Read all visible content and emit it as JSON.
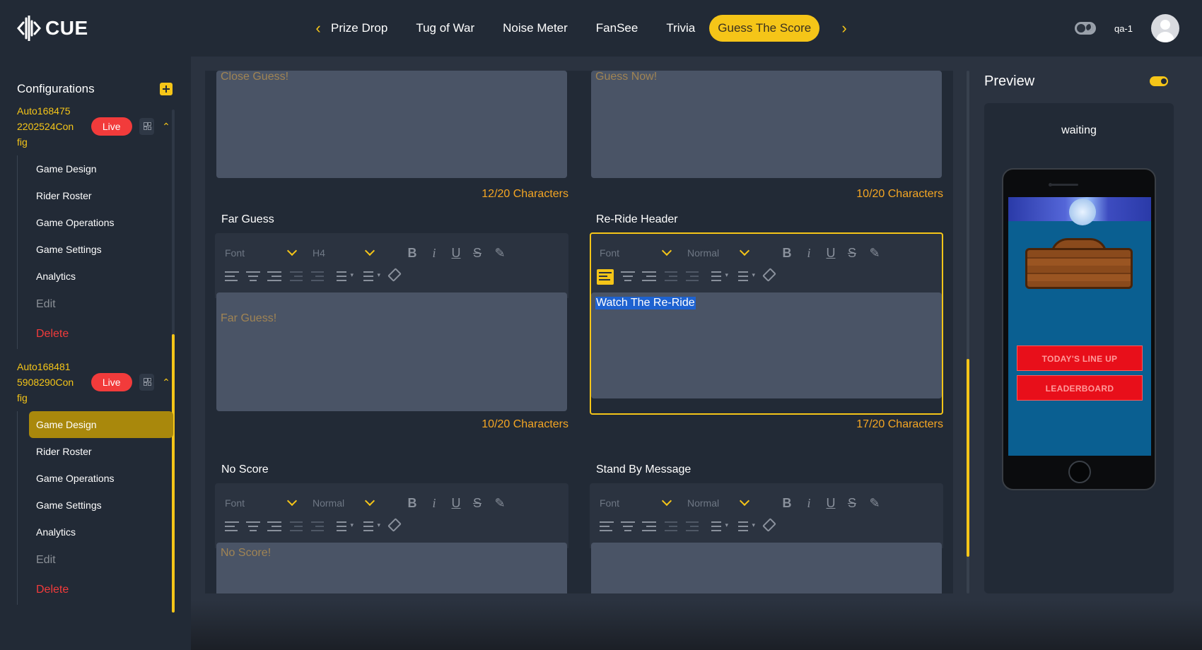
{
  "app": {
    "logo_text": "CUE"
  },
  "nav": {
    "tabs": [
      "Prize Drop",
      "Tug of War",
      "Noise Meter",
      "FanSee",
      "Trivia",
      "Guess The Score"
    ],
    "active_tab": "Guess The Score"
  },
  "user": {
    "name": "qa-1"
  },
  "sidebar": {
    "title": "Configurations",
    "configs": [
      {
        "name": "Auto1684752202524Config",
        "status": "Live",
        "items": [
          "Game Design",
          "Rider Roster",
          "Game Operations",
          "Game Settings",
          "Analytics"
        ],
        "edit_label": "Edit",
        "delete_label": "Delete"
      },
      {
        "name": "Auto1684815908290Config",
        "status": "Live",
        "items": [
          "Game Design",
          "Rider Roster",
          "Game Operations",
          "Game Settings",
          "Analytics"
        ],
        "active_item": "Game Design",
        "edit_label": "Edit",
        "delete_label": "Delete"
      }
    ]
  },
  "editor": {
    "fields": [
      {
        "label": "",
        "text": "Close Guess!",
        "counter": "12/20 Characters"
      },
      {
        "label": "",
        "text": "Guess Now!",
        "counter": "10/20 Characters"
      },
      {
        "label": "Far Guess",
        "font": "Font",
        "size": "H4",
        "text": "Far Guess!",
        "counter": "10/20 Characters"
      },
      {
        "label": "Re-Ride Header",
        "font": "Font",
        "size": "Normal",
        "text": "Watch The Re-Ride",
        "counter": "17/20 Characters"
      },
      {
        "label": "No Score",
        "font": "Font",
        "size": "Normal",
        "text": "No Score!"
      },
      {
        "label": "Stand By Message",
        "font": "Font",
        "size": "Normal",
        "text": ""
      }
    ]
  },
  "preview": {
    "title": "Preview",
    "status": "waiting",
    "buttons": [
      "TODAY'S LINE UP",
      "LEADERBOARD"
    ]
  },
  "colors": {
    "accent": "#f5c518",
    "live": "#f23b3b",
    "counter": "#f5a623",
    "selection": "#1e62d0"
  }
}
